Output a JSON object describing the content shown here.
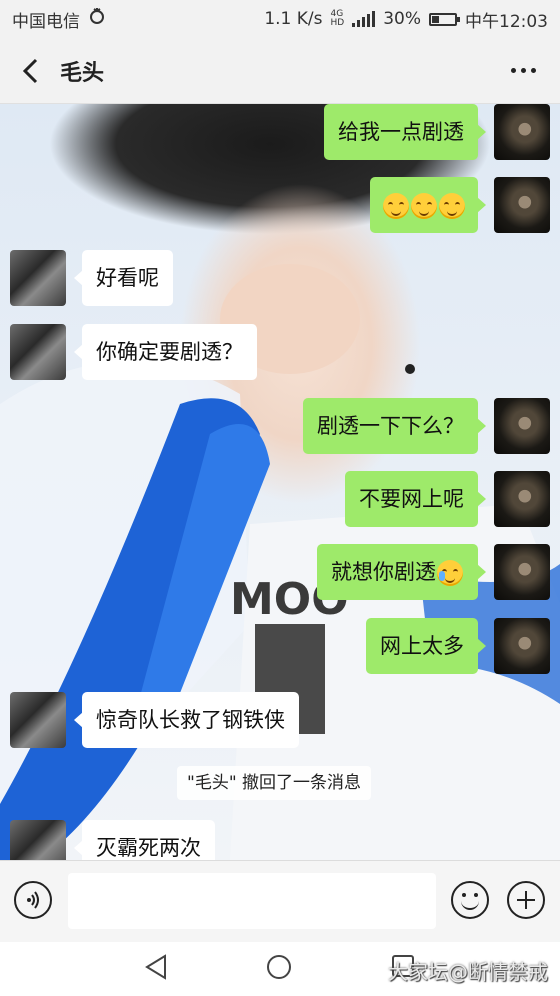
{
  "status_bar": {
    "carrier": "中国电信",
    "speed": "1.1 K/s",
    "net_type_top": "4G",
    "net_type_bottom": "HD",
    "battery": "30%",
    "battery_level": 0.3,
    "time": "中午12:03"
  },
  "header": {
    "title": "毛头"
  },
  "messages": [
    {
      "side": "right",
      "text": "给我一点剧透"
    },
    {
      "side": "right",
      "emoji": [
        "smirk",
        "smirk",
        "smirk"
      ]
    },
    {
      "side": "left",
      "text": "好看呢"
    },
    {
      "side": "left",
      "text": "你确定要剧透？"
    },
    {
      "side": "right",
      "text": "剧透一下下么？"
    },
    {
      "side": "right",
      "text": "不要网上呢"
    },
    {
      "side": "right",
      "text": "就想你剧透",
      "emoji": [
        "laugh-cry"
      ]
    },
    {
      "side": "right",
      "text": "网上太多"
    },
    {
      "side": "left",
      "text": "惊奇队长救了钢铁侠"
    },
    {
      "side": "system",
      "text": "\"毛头\" 撤回了一条消息"
    },
    {
      "side": "left",
      "text": "灭霸死两次"
    }
  ],
  "input": {
    "value": "",
    "placeholder": ""
  },
  "watermark": "大家坛@断情禁戒",
  "colors": {
    "my_bubble": "#9eea6a",
    "their_bubble": "#ffffff",
    "bar_bg": "#f2f2f2"
  }
}
